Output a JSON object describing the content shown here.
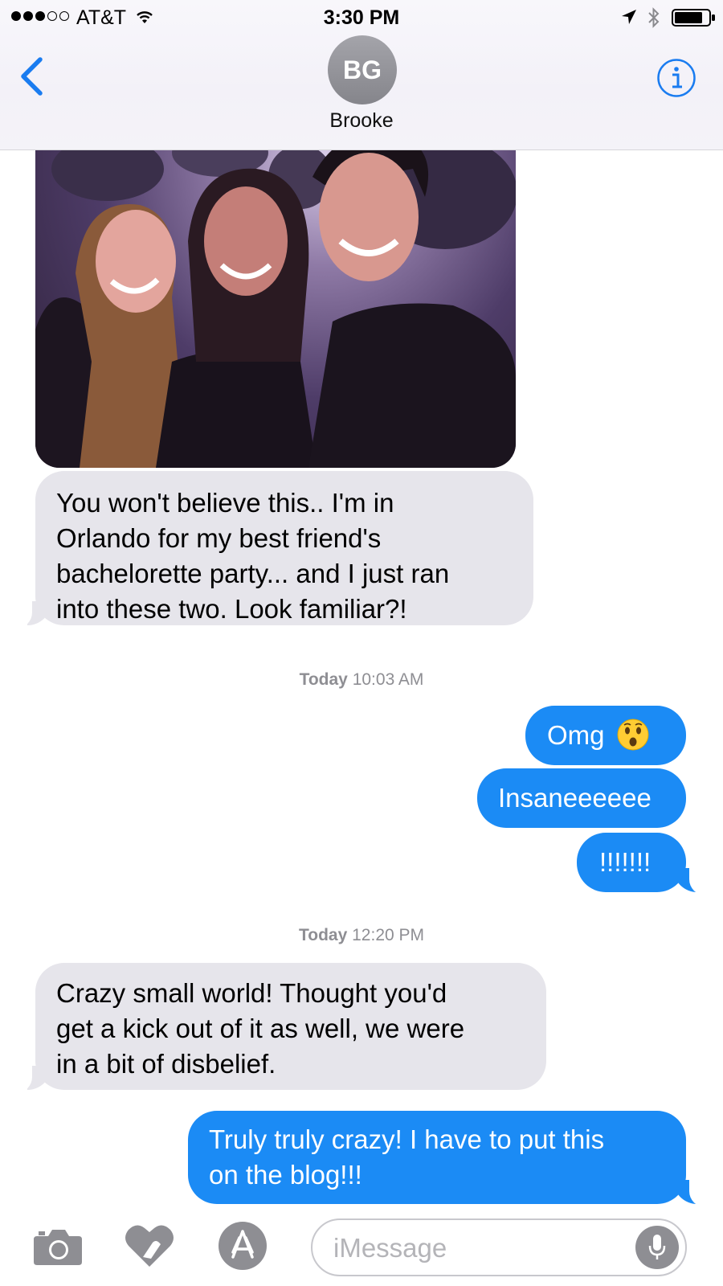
{
  "status_bar": {
    "carrier": "AT&T",
    "time": "3:30 PM",
    "signal_bars_filled": 3,
    "signal_bars_total": 5,
    "battery_level": 0.8
  },
  "header": {
    "contact_initials": "BG",
    "contact_name": "Brooke"
  },
  "messages": [
    {
      "direction": "incoming",
      "type": "photo",
      "alt": ""
    },
    {
      "direction": "incoming",
      "lines": [
        "You won't believe this.. I'm in",
        "Orlando for my best friend's",
        "bachelorette party... and I just ran",
        "into these two. Look familiar?!"
      ]
    },
    {
      "type": "timestamp",
      "day": "Today",
      "time": "10:03 AM"
    },
    {
      "direction": "outgoing",
      "text": "Omg",
      "emoji": "hushed-face"
    },
    {
      "direction": "outgoing",
      "text": "Insaneeeeee"
    },
    {
      "direction": "outgoing",
      "text": "!!!!!!!"
    },
    {
      "type": "timestamp",
      "day": "Today",
      "time": "12:20 PM"
    },
    {
      "direction": "incoming",
      "lines": [
        "Crazy small world! Thought you'd",
        "get a kick out of it as well, we were",
        "in a bit of disbelief."
      ]
    },
    {
      "direction": "outgoing",
      "lines": [
        "Truly truly crazy! I have to put this",
        "on the blog!!!"
      ]
    }
  ],
  "input_bar": {
    "placeholder": "iMessage",
    "value": "",
    "icons": [
      "camera-icon",
      "digital-touch-icon",
      "app-store-icon",
      "microphone-icon"
    ]
  },
  "colors": {
    "outgoing_bubble": "#1b8bf5",
    "incoming_bubble": "#e6e5eb",
    "accent": "#1a7cf0",
    "timestamp_text": "#8e8e93"
  }
}
